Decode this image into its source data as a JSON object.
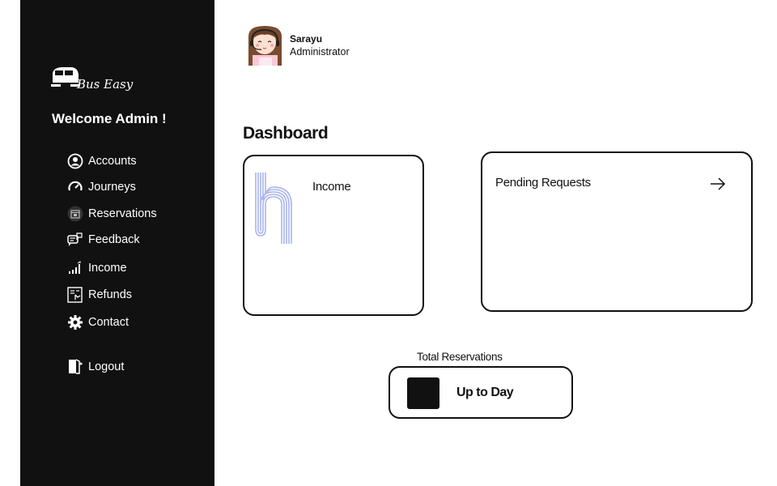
{
  "brand": {
    "logo_text": "Bus Easy"
  },
  "sidebar": {
    "welcome": "Welcome Admin !",
    "items": [
      {
        "label": "Accounts",
        "icon": "user-circle-icon"
      },
      {
        "label": "Journeys",
        "icon": "gauge-icon"
      },
      {
        "label": "Reservations",
        "icon": "calendar-icon"
      },
      {
        "label": "Feedback",
        "icon": "feedback-icon"
      },
      {
        "label": "Income",
        "icon": "signal-bars-icon"
      },
      {
        "label": "Refunds",
        "icon": "refund-receipt-icon"
      },
      {
        "label": "Contact",
        "icon": "gear-icon"
      }
    ],
    "logout": {
      "label": "Logout",
      "icon": "door-exit-icon"
    }
  },
  "profile": {
    "name": "Sarayu",
    "role": "Administrator"
  },
  "main": {
    "title": "Dashboard",
    "income_card": {
      "label": "Income"
    },
    "pending_card": {
      "label": "Pending Requests"
    },
    "total_reservations": {
      "label": "Total Reservations",
      "value": "Up to Day"
    }
  },
  "colors": {
    "sidebar_bg": "#111111",
    "accent": "#a9b4ee",
    "text": "#111111",
    "background": "#ffffff"
  }
}
